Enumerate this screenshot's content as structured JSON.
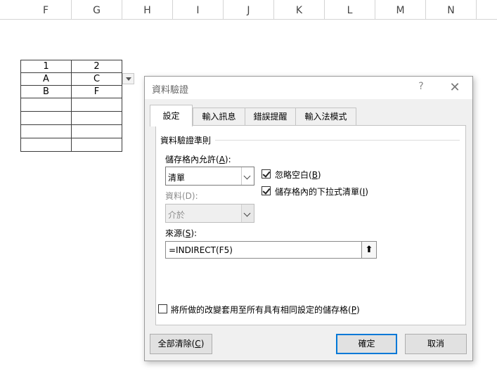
{
  "sheet": {
    "columns": [
      "F",
      "G",
      "H",
      "I",
      "J",
      "K",
      "L",
      "M",
      "N"
    ],
    "table": {
      "header": [
        "1",
        "2"
      ],
      "rows": [
        [
          "A",
          "C"
        ],
        [
          "B",
          "F"
        ],
        [
          "",
          ""
        ],
        [
          "",
          ""
        ],
        [
          "",
          ""
        ],
        [
          "",
          ""
        ]
      ]
    }
  },
  "dialog": {
    "title": "資料驗證",
    "help": "?",
    "close": "✕",
    "tabs": [
      "設定",
      "輸入訊息",
      "錯誤提醒",
      "輸入法模式"
    ],
    "group_label": "資料驗證準則",
    "allow_label": "儲存格內允許(",
    "allow_key": "A",
    "allow_tail": "):",
    "allow_value": "清單",
    "data_label": "資料(D):",
    "data_value": "介於",
    "ignore_blank_label": "忽略空白(",
    "ignore_blank_key": "B",
    "ignore_blank_checked": true,
    "in_cell_dropdown_label": "儲存格內的下拉式清單(",
    "in_cell_dropdown_key": "I",
    "in_cell_dropdown_checked": true,
    "source_label": "來源(",
    "source_key": "S",
    "source_value": "=INDIRECT(F5)",
    "collapse_icon": "⬆",
    "apply_all_label": "將所做的改變套用至所有具有相同設定的儲存格(",
    "apply_all_key": "P",
    "apply_all_checked": false,
    "clear_all_label": "全部清除(",
    "clear_all_key": "C",
    "close_paren": ")",
    "close_paren_colon": "):",
    "ok_label": "確定",
    "cancel_label": "取消"
  }
}
